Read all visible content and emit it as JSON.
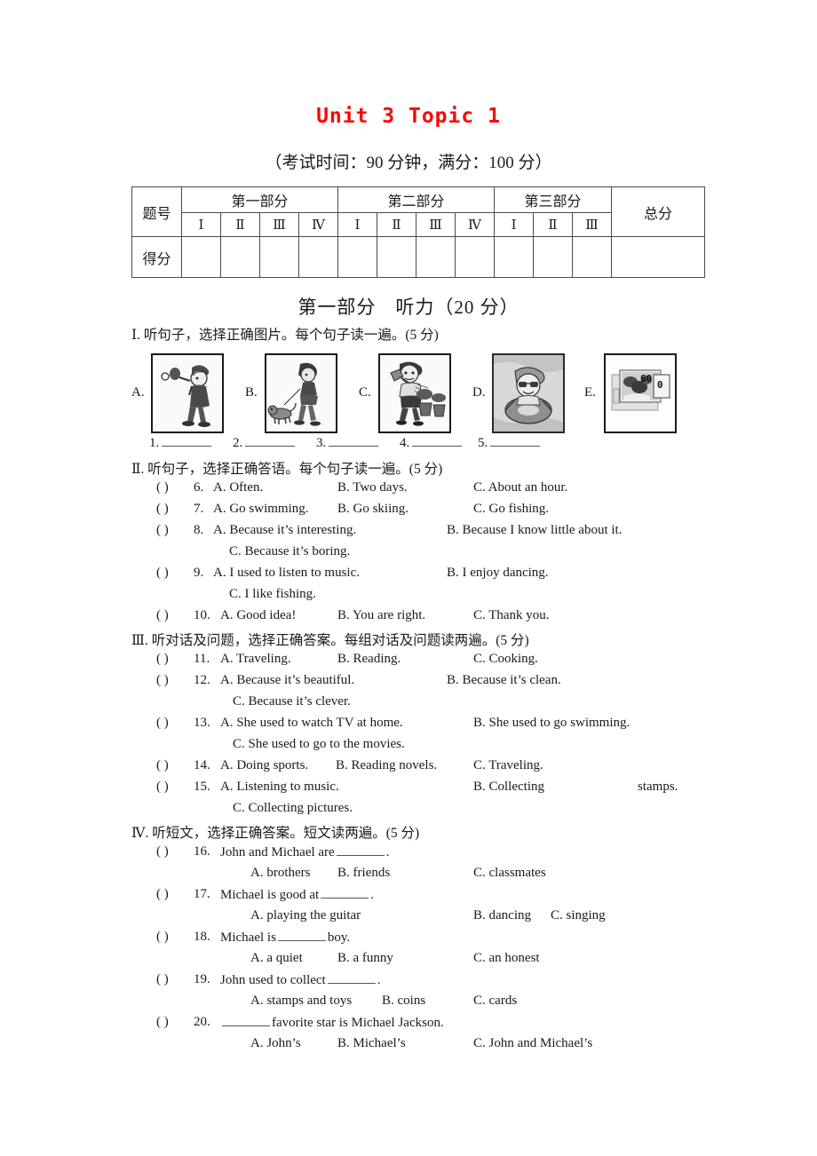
{
  "title": "Unit 3  Topic 1",
  "exam_info": "（考试时间：90 分钟，满分：100 分）",
  "score_table": {
    "row_label_1": "题号",
    "row_label_2": "得分",
    "part_headers": [
      "第一部分",
      "第二部分",
      "第三部分"
    ],
    "total_header": "总分",
    "part1_romans": [
      "Ⅰ",
      "Ⅱ",
      "Ⅲ",
      "Ⅳ"
    ],
    "part2_romans": [
      "Ⅰ",
      "Ⅱ",
      "Ⅲ",
      "Ⅳ"
    ],
    "part3_romans": [
      "Ⅰ",
      "Ⅱ",
      "Ⅲ"
    ]
  },
  "part_one_heading": "第一部分　听力（20 分）",
  "sections": {
    "s1": {
      "num": "Ⅰ.",
      "instruction": "听句子，选择正确图片。每个句子读一遍。(5 分)",
      "pictures": [
        {
          "letter": "A.",
          "icon": "table-tennis-boy-picture"
        },
        {
          "letter": "B.",
          "icon": "girl-walking-dog-picture"
        },
        {
          "letter": "C.",
          "icon": "man-watering-plants-picture"
        },
        {
          "letter": "D.",
          "icon": "person-swim-ring-picture"
        },
        {
          "letter": "E.",
          "icon": "stamps-collection-picture"
        }
      ],
      "blanks": [
        "1.",
        "2.",
        "3.",
        "4.",
        "5."
      ]
    },
    "s2": {
      "num": "Ⅱ.",
      "instruction": "听句子，选择正确答语。每个句子读一遍。(5 分)",
      "questions": [
        {
          "paren": "(    )",
          "num": "6.",
          "a": "A. Often.",
          "b": "B. Two days.",
          "c": "C. About an hour."
        },
        {
          "paren": "(    )",
          "num": "7.",
          "a": "A. Go swimming.",
          "b": "B. Go skiing.",
          "c": "C. Go fishing."
        },
        {
          "paren": "(    )",
          "num": "8.",
          "a": "A. Because it’s interesting.",
          "b": "B. Because I know little about it.",
          "c": "C. Because it’s boring."
        },
        {
          "paren": "(    )",
          "num": "9.",
          "a": "A. I used to listen to music.",
          "b": "B. I enjoy dancing.",
          "c": "C. I like fishing."
        },
        {
          "paren": "(    )",
          "num": "10.",
          "a": "A. Good idea!",
          "b": "B. You are right.",
          "c": "C. Thank you."
        }
      ]
    },
    "s3": {
      "num": "Ⅲ.",
      "instruction": "听对话及问题，选择正确答案。每组对话及问题读两遍。(5 分)",
      "questions": [
        {
          "paren": "(    )",
          "num": "11.",
          "a": "A. Traveling.",
          "b": "B. Reading.",
          "c": "C. Cooking."
        },
        {
          "paren": "(    )",
          "num": "12.",
          "a": "A. Because it’s beautiful.",
          "b": "B. Because it’s clean.",
          "c": "C. Because it’s clever."
        },
        {
          "paren": "(    )",
          "num": "13.",
          "a": "A. She used to watch TV at home.",
          "b": "B. She used to go swimming.",
          "c": "C. She used to go to the movies."
        },
        {
          "paren": "(    )",
          "num": "14.",
          "a": "A. Doing sports.",
          "b": "B. Reading novels.",
          "c": "C. Traveling."
        },
        {
          "paren": "(    )",
          "num": "15.",
          "a": "A. Listening to music.",
          "b": "B. Collecting",
          "b_tail": "stamps.",
          "c": "C. Collecting pictures."
        }
      ]
    },
    "s4": {
      "num": "Ⅳ.",
      "instruction": "听短文，选择正确答案。短文读两遍。(5 分)",
      "questions": [
        {
          "paren": "(    )",
          "num": "16.",
          "stem_pre": "John and Michael are",
          "stem_post": ".",
          "a": "A. brothers",
          "b": "B. friends",
          "c": "C. classmates"
        },
        {
          "paren": "(    )",
          "num": "17.",
          "stem_pre": "Michael is good at",
          "stem_post": ".",
          "a": "A. playing the guitar",
          "b": "B. dancing",
          "c": "C. singing"
        },
        {
          "paren": "(    )",
          "num": "18.",
          "stem_pre": "Michael is",
          "stem_post": "boy.",
          "a": "A. a quiet",
          "b": "B. a funny",
          "c": "C. an honest"
        },
        {
          "paren": "(    )",
          "num": "19.",
          "stem_pre": "John used to collect",
          "stem_post": ".",
          "a": "A. stamps and toys",
          "b": "B. coins",
          "c": "C. cards"
        },
        {
          "paren": "(    )",
          "num": "20.",
          "stem_pre": "",
          "stem_post": "favorite star is Michael Jackson.",
          "a": "A. John’s",
          "b": "B. Michael’s",
          "c": "C. John and Michael’s"
        }
      ]
    }
  },
  "colors": {
    "title": "#ff0000",
    "text": "#1a1a1a",
    "rule": "#4a4a4a"
  }
}
